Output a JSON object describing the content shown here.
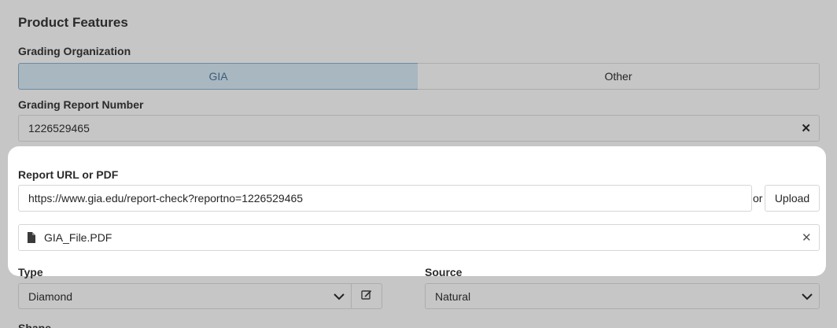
{
  "section_title": "Product Features",
  "grading_org": {
    "label": "Grading Organization",
    "options": [
      "GIA",
      "Other"
    ],
    "selected": "GIA"
  },
  "report_number": {
    "label": "Grading Report Number",
    "value": "1226529465",
    "clear_glyph": "✕"
  },
  "report_url": {
    "label": "Report URL or PDF",
    "value": "https://www.gia.edu/report-check?reportno=1226529465",
    "or_text": "or",
    "upload_label": "Upload",
    "file_name": "GIA_File.PDF",
    "file_remove_glyph": "✕"
  },
  "type": {
    "label": "Type",
    "value": "Diamond"
  },
  "source": {
    "label": "Source",
    "value": "Natural"
  },
  "next_label": "Shape",
  "colors": {
    "overlay_bg": "#c6c6c6",
    "selected_segment_bg": "#a9b7c0",
    "selected_segment_text": "#3a5e7a",
    "card_bg": "#ffffff"
  },
  "icons": [
    "file-icon",
    "edit-icon",
    "chevron-down-icon",
    "close-icon"
  ]
}
